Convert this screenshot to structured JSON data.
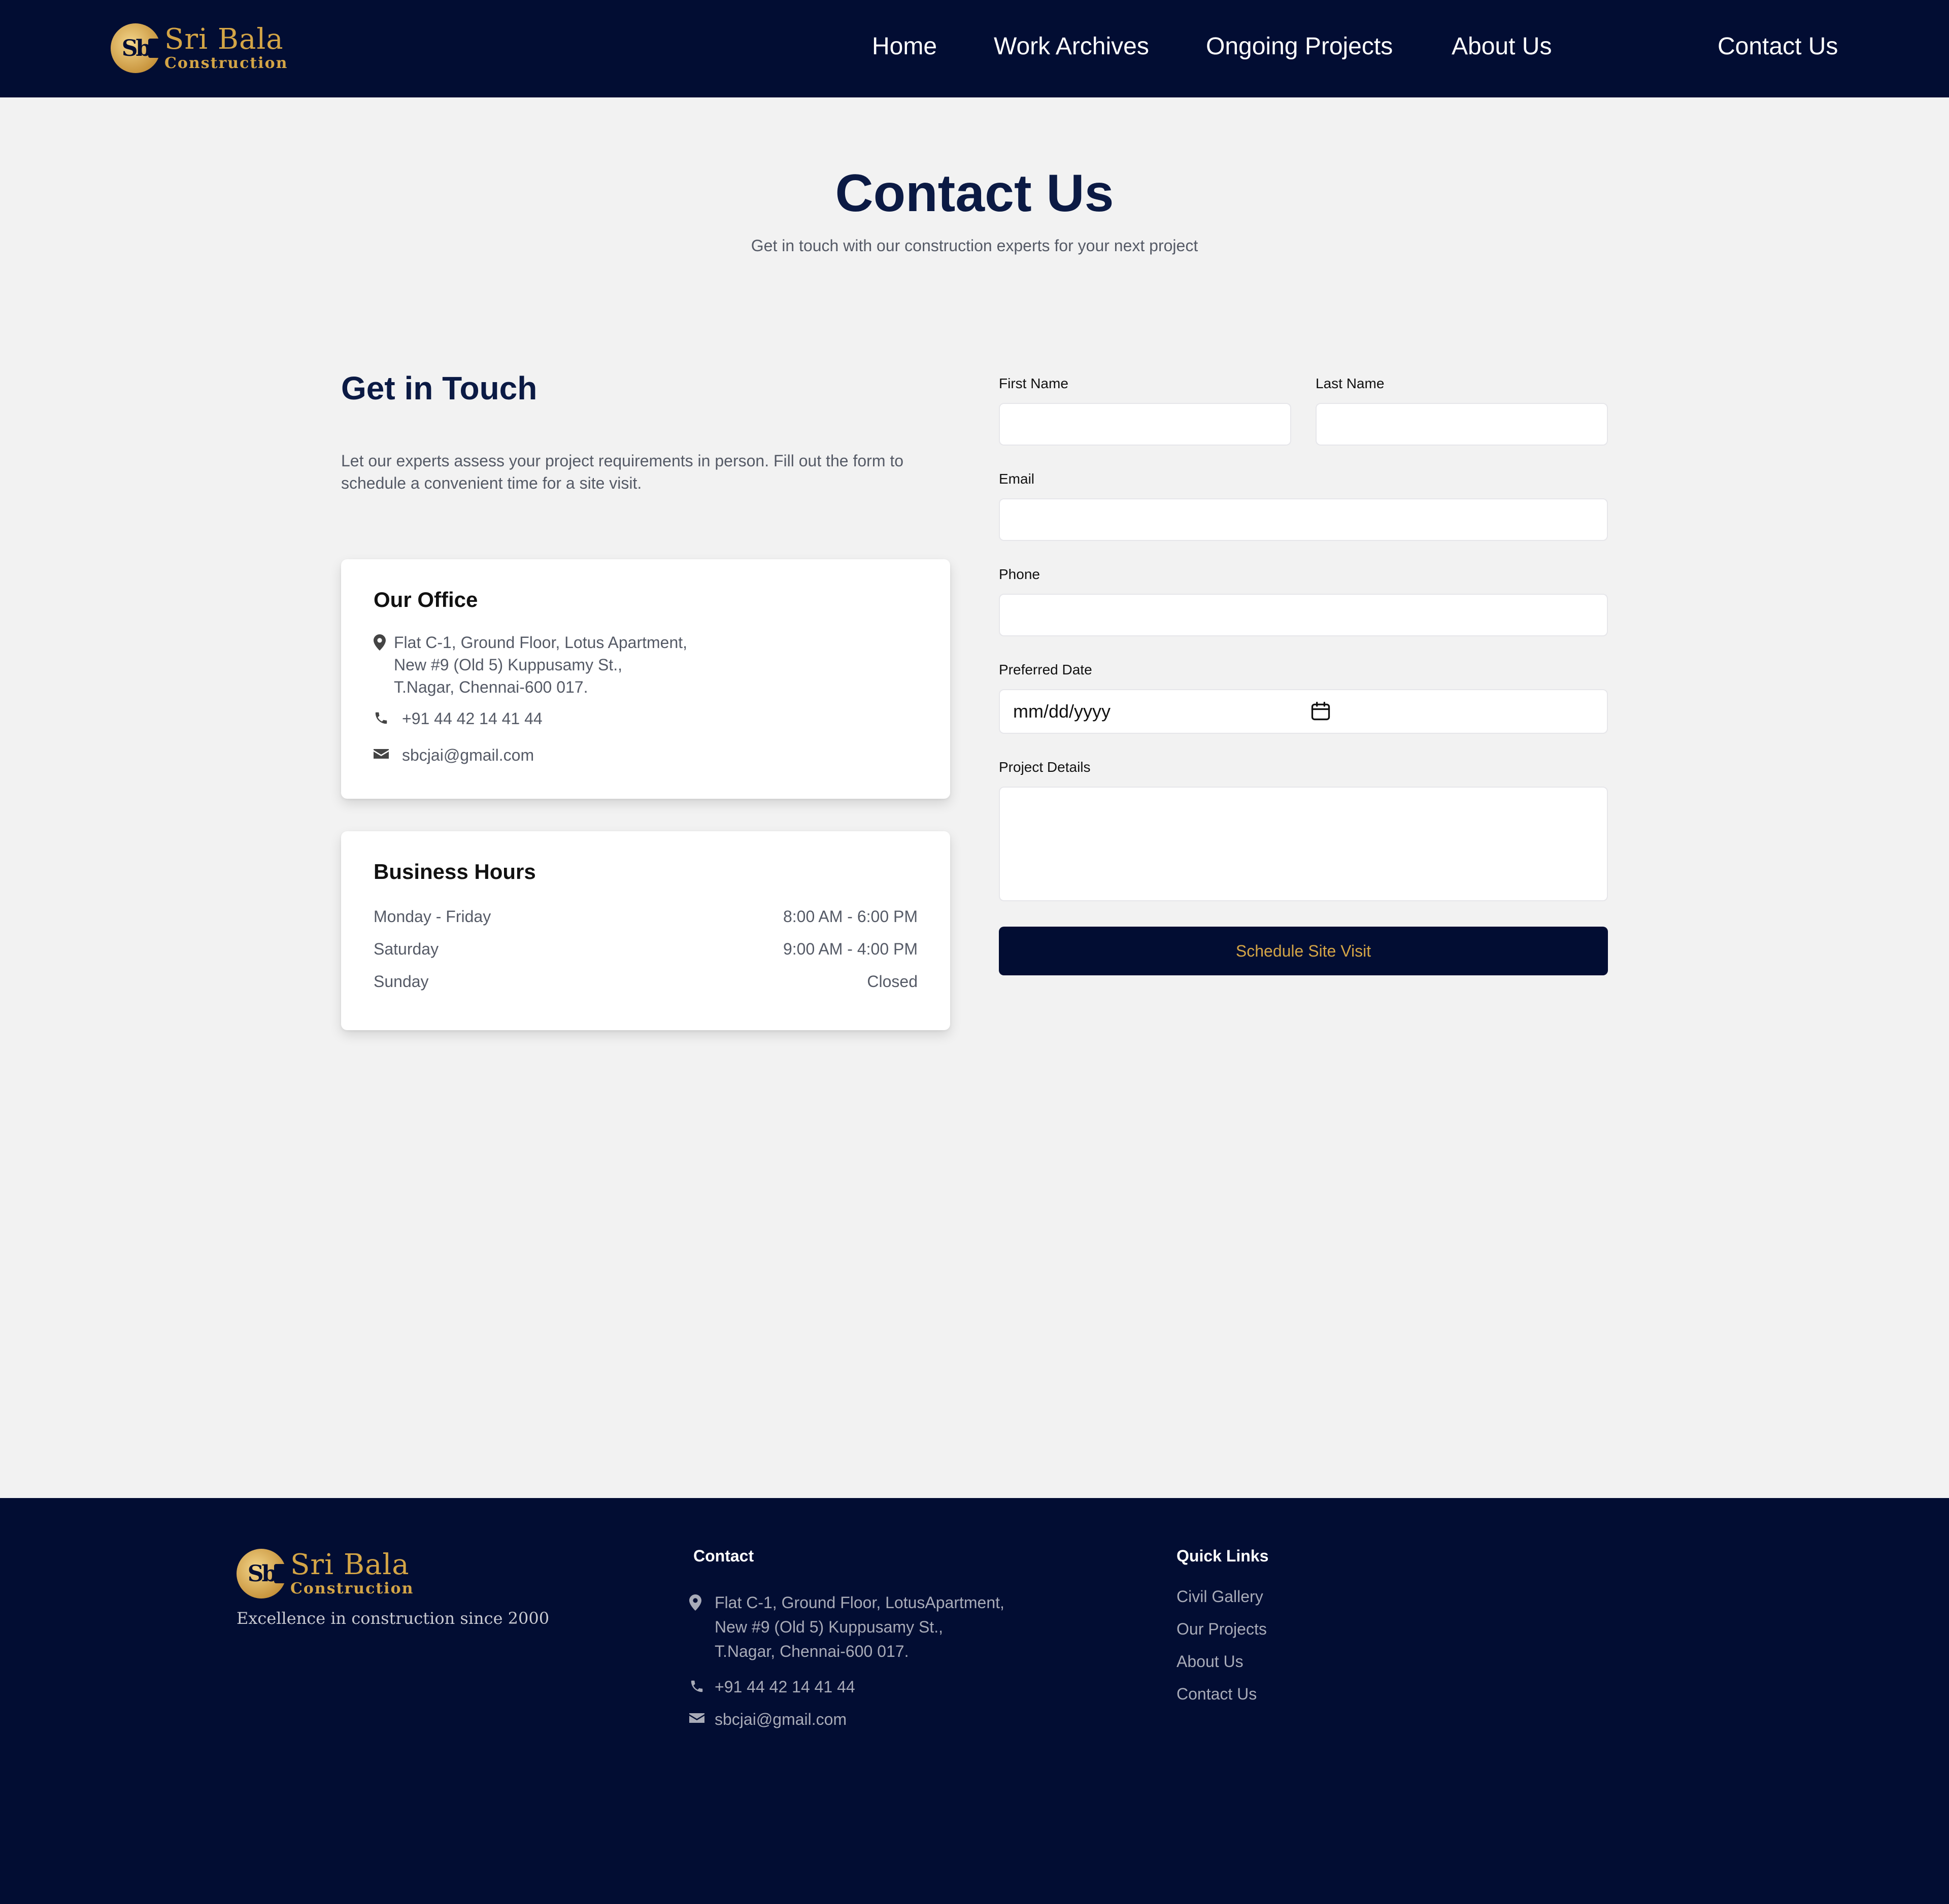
{
  "brand": {
    "mark": "Sb",
    "name": "Sri Bala",
    "subtitle": "Construction",
    "tagline": "Excellence in construction since 2000"
  },
  "nav": {
    "home": "Home",
    "work_archives": "Work Archives",
    "ongoing_projects": "Ongoing Projects",
    "about_us": "About Us",
    "contact_us": "Contact Us"
  },
  "hero": {
    "title": "Contact Us",
    "subtitle": "Get in touch with our construction experts for your next project"
  },
  "intro": {
    "title": "Get in Touch",
    "text": "Let our experts assess your project requirements in person. Fill out the form to schedule a convenient time for a site visit."
  },
  "office": {
    "title": "Our Office",
    "address": "Flat C-1, Ground Floor, Lotus Apartment,\nNew #9 (Old 5) Kuppusamy St.,\nT.Nagar, Chennai-600 017.",
    "phone": "+91 44 42 14 41 44",
    "email": "sbcjai@gmail.com"
  },
  "hours": {
    "title": "Business Hours",
    "rows": [
      {
        "day": "Monday - Friday",
        "time": "8:00 AM - 6:00 PM"
      },
      {
        "day": "Saturday",
        "time": "9:00 AM - 4:00 PM"
      },
      {
        "day": "Sunday",
        "time": "Closed"
      }
    ]
  },
  "form": {
    "first_name_label": "First Name",
    "first_name_value": "",
    "last_name_label": "Last Name",
    "last_name_value": "",
    "email_label": "Email",
    "email_value": "",
    "phone_label": "Phone",
    "phone_value": "",
    "date_label": "Preferred Date",
    "date_placeholder": "mm/dd/yyyy",
    "details_label": "Project Details",
    "details_value": "",
    "submit_label": "Schedule Site Visit"
  },
  "footer": {
    "contact_heading": "Contact",
    "address": "Flat C-1, Ground Floor, LotusApartment,\nNew #9 (Old 5) Kuppusamy St.,\nT.Nagar, Chennai-600 017.",
    "phone": "+91 44 42 14 41 44",
    "email": "sbcjai@gmail.com",
    "quick_links_heading": "Quick Links",
    "links": [
      "Civil Gallery",
      "Our Projects",
      "About Us",
      "Contact Us"
    ]
  },
  "colors": {
    "navy": "#020d33",
    "gold": "#d4a546",
    "page_bg": "#f2f2f2"
  },
  "icons": [
    "map-pin-icon",
    "phone-icon",
    "envelope-icon",
    "calendar-icon"
  ]
}
